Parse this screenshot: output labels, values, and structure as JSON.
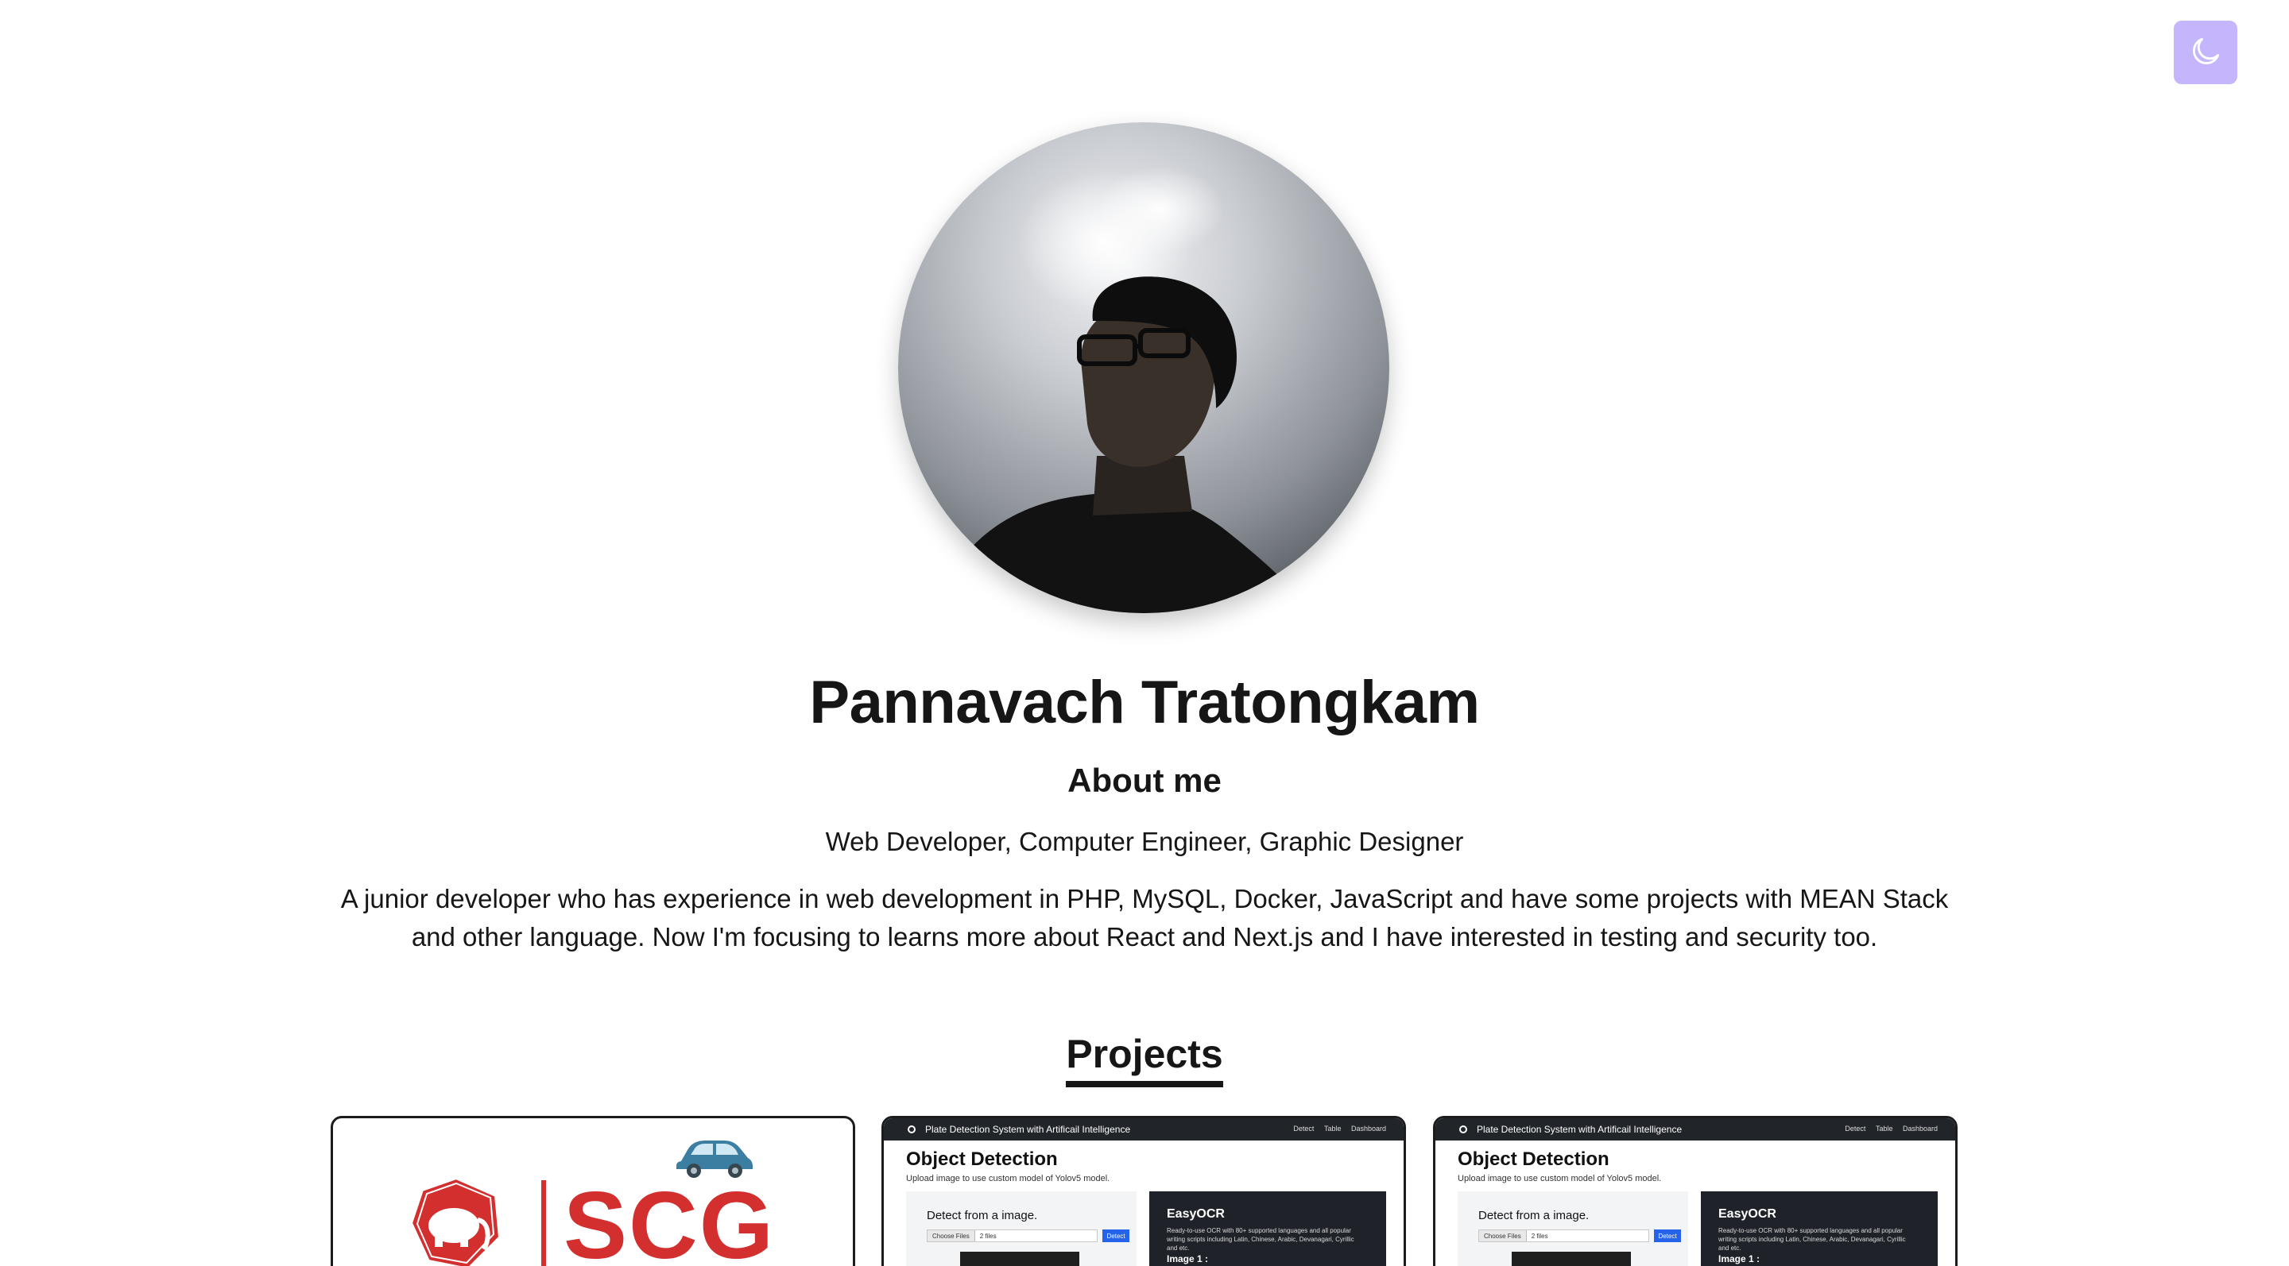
{
  "theme_toggle": {
    "icon": "moon-icon",
    "accent": "#c4b5fd"
  },
  "profile": {
    "name": "Pannavach Tratongkam",
    "about_heading": "About me",
    "roles": "Web Developer, Computer Engineer, Graphic Designer",
    "bio": "A junior developer who has experience in web development in PHP, MySQL, Docker, JavaScript and have some projects with MEAN Stack and other language. Now I'm focusing to learns more about React and Next.js and I have interested in testing and security too."
  },
  "projects": {
    "heading": "Projects",
    "cards": [
      {
        "logo_text": "SCG",
        "brand_color": "#d32f2f",
        "icon": "car-icon"
      },
      {
        "nav_title": "Plate Detection System with Artificail Intelligence",
        "nav_links": [
          "Detect",
          "Table",
          "Dashboard"
        ],
        "title": "Object Detection",
        "subtitle": "Upload image to use custom model of Yolov5 model.",
        "detect_label": "Detect from a image.",
        "choose_label": "Choose Files",
        "file_count": "2 files",
        "detect_button": "Detect",
        "panel_title": "EasyOCR",
        "panel_text": "Ready-to-use OCR with 80+ supported languages and all popular writing scripts including Latin, Chinese, Arabic, Devanagari, Cyrillic and etc.",
        "image_label": "Image 1 :"
      },
      {
        "nav_title": "Plate Detection System with Artificail Intelligence",
        "nav_links": [
          "Detect",
          "Table",
          "Dashboard"
        ],
        "title": "Object Detection",
        "subtitle": "Upload image to use custom model of Yolov5 model.",
        "detect_label": "Detect from a image.",
        "choose_label": "Choose Files",
        "file_count": "2 files",
        "detect_button": "Detect",
        "panel_title": "EasyOCR",
        "panel_text": "Ready-to-use OCR with 80+ supported languages and all popular writing scripts including Latin, Chinese, Arabic, Devanagari, Cyrillic and etc.",
        "image_label": "Image 1 :"
      }
    ]
  }
}
